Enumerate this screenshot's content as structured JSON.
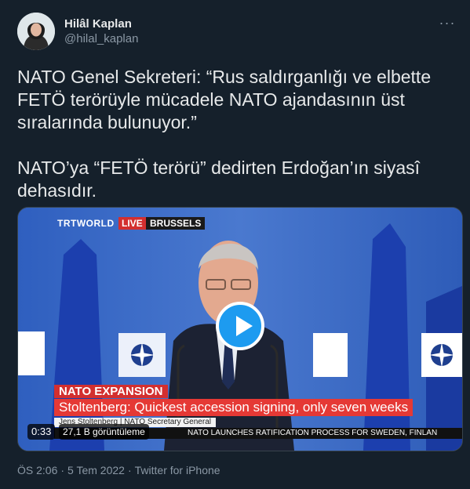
{
  "author": {
    "display_name": "Hilâl Kaplan",
    "handle": "@hilal_kaplan"
  },
  "more_icon": "more-dots-icon",
  "tweet": {
    "text": "NATO Genel Sekreteri: “Rus saldırganlığı ve elbette FETÖ terörüyle mücadele NATO ajandasının üst sıralarında bulunuyor.”\n\nNATO’ya “FETÖ terörü” dedirten Erdoğan’ın siyasî dehasıdır."
  },
  "video": {
    "channel": "TRTWORLD",
    "live": "LIVE",
    "location": "BRUSSELS",
    "podium_sign_left": "NATO\nOTAN",
    "podium_sign_right": "NATO\nOTAN",
    "tag": "NATO EXPANSION",
    "headline": "Stoltenberg: Quickest accession signing, only seven weeks",
    "speaker": "Jens Stoltenberg | NATO Secretary General",
    "ticker": "NATO LAUNCHES RATIFICATION PROCESS FOR SWEDEN, FINLAN",
    "time": "0:33",
    "views": "27,1 B görüntüleme",
    "play_icon": "play-icon"
  },
  "meta": {
    "time": "ÖS 2:06",
    "sep1": "·",
    "date": "5 Tem 2022",
    "sep2": "·",
    "source": "Twitter for iPhone"
  },
  "colors": {
    "background": "#15202b",
    "accent": "#1d9bf0",
    "muted": "#8b98a5",
    "text": "#e7e9ea"
  }
}
